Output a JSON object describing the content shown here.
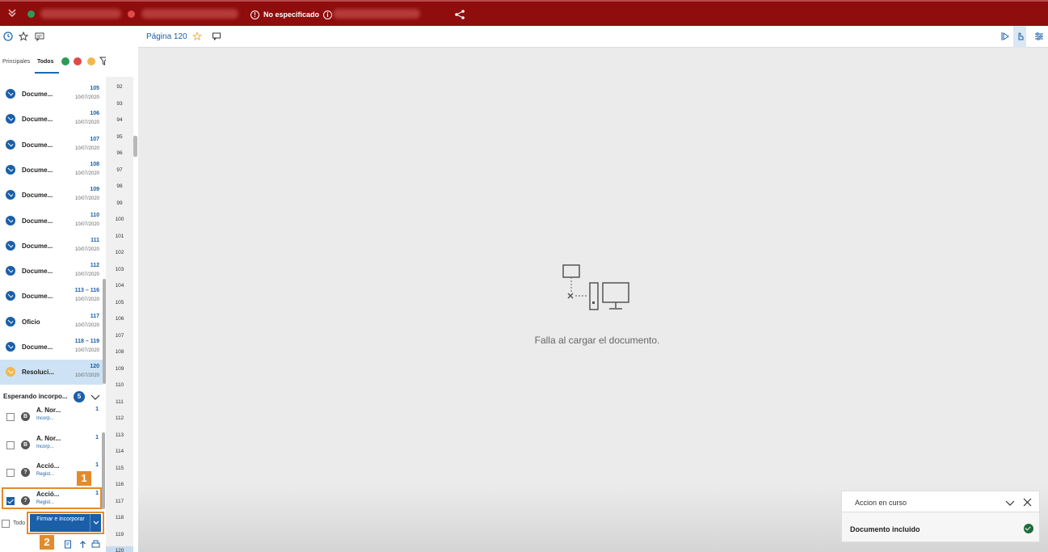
{
  "topbar": {
    "status_text": "No especificado",
    "status_icon": "info-circle-icon",
    "accent": "#8f0d0d"
  },
  "left_panel": {
    "icon_tabs": [
      "clock-icon",
      "star-icon",
      "comment-icon"
    ],
    "filter_tabs": [
      "Principales",
      "Todos"
    ],
    "active_filter": "Todos",
    "items": [
      {
        "name": "Docume...",
        "page": "105",
        "date": "10/07/2020",
        "icon": "yellow"
      },
      {
        "name": "Docume...",
        "page": "106",
        "date": "10/07/2020"
      },
      {
        "name": "Docume...",
        "page": "107",
        "date": "10/07/2020"
      },
      {
        "name": "Docume...",
        "page": "108",
        "date": "10/07/2020"
      },
      {
        "name": "Docume...",
        "page": "109",
        "date": "10/07/2020"
      },
      {
        "name": "Docume...",
        "page": "110",
        "date": "10/07/2020"
      },
      {
        "name": "Docume...",
        "page": "111",
        "date": "10/07/2020"
      },
      {
        "name": "Docume...",
        "page": "112",
        "date": "10/07/2020"
      },
      {
        "name": "Docume...",
        "page": "113 – 116",
        "date": "10/07/2020"
      },
      {
        "name": "Oficio",
        "page": "117",
        "date": "10/07/2020"
      },
      {
        "name": "Docume...",
        "page": "118 – 119",
        "date": "10/07/2020"
      },
      {
        "name": "Resoluci...",
        "page": "120",
        "date": "10/07/2020"
      }
    ],
    "waiting": {
      "label": "Esperando incorpo...",
      "count": "5",
      "items": [
        {
          "name": "A. Nor...",
          "sub": "Incorp...",
          "num": "1",
          "icon": "B",
          "checked": false
        },
        {
          "name": "A. Nor...",
          "sub": "Incorp...",
          "num": "1",
          "icon": "B",
          "checked": false
        },
        {
          "name": "Acció...",
          "sub": "Regist...",
          "num": "1",
          "icon": "?",
          "checked": false
        },
        {
          "name": "Acció...",
          "sub": "Regist...",
          "num": "1",
          "icon": "?",
          "checked": true
        }
      ]
    },
    "select_all_label": "Todo",
    "sign_button": "Firmar e incorporar",
    "markers": [
      "1",
      "2"
    ]
  },
  "page_numbers": [
    "92",
    "93",
    "94",
    "95",
    "96",
    "97",
    "98",
    "99",
    "100",
    "101",
    "102",
    "103",
    "104",
    "105",
    "106",
    "107",
    "108",
    "109",
    "110",
    "111",
    "112",
    "113",
    "114",
    "115",
    "116",
    "117",
    "118",
    "119",
    "120"
  ],
  "current_page": "120",
  "document": {
    "title": "Página 120",
    "error_message": "Falla al cargar el documento."
  },
  "toast": {
    "title": "Accion  en curso",
    "body": "Documento incluido"
  }
}
